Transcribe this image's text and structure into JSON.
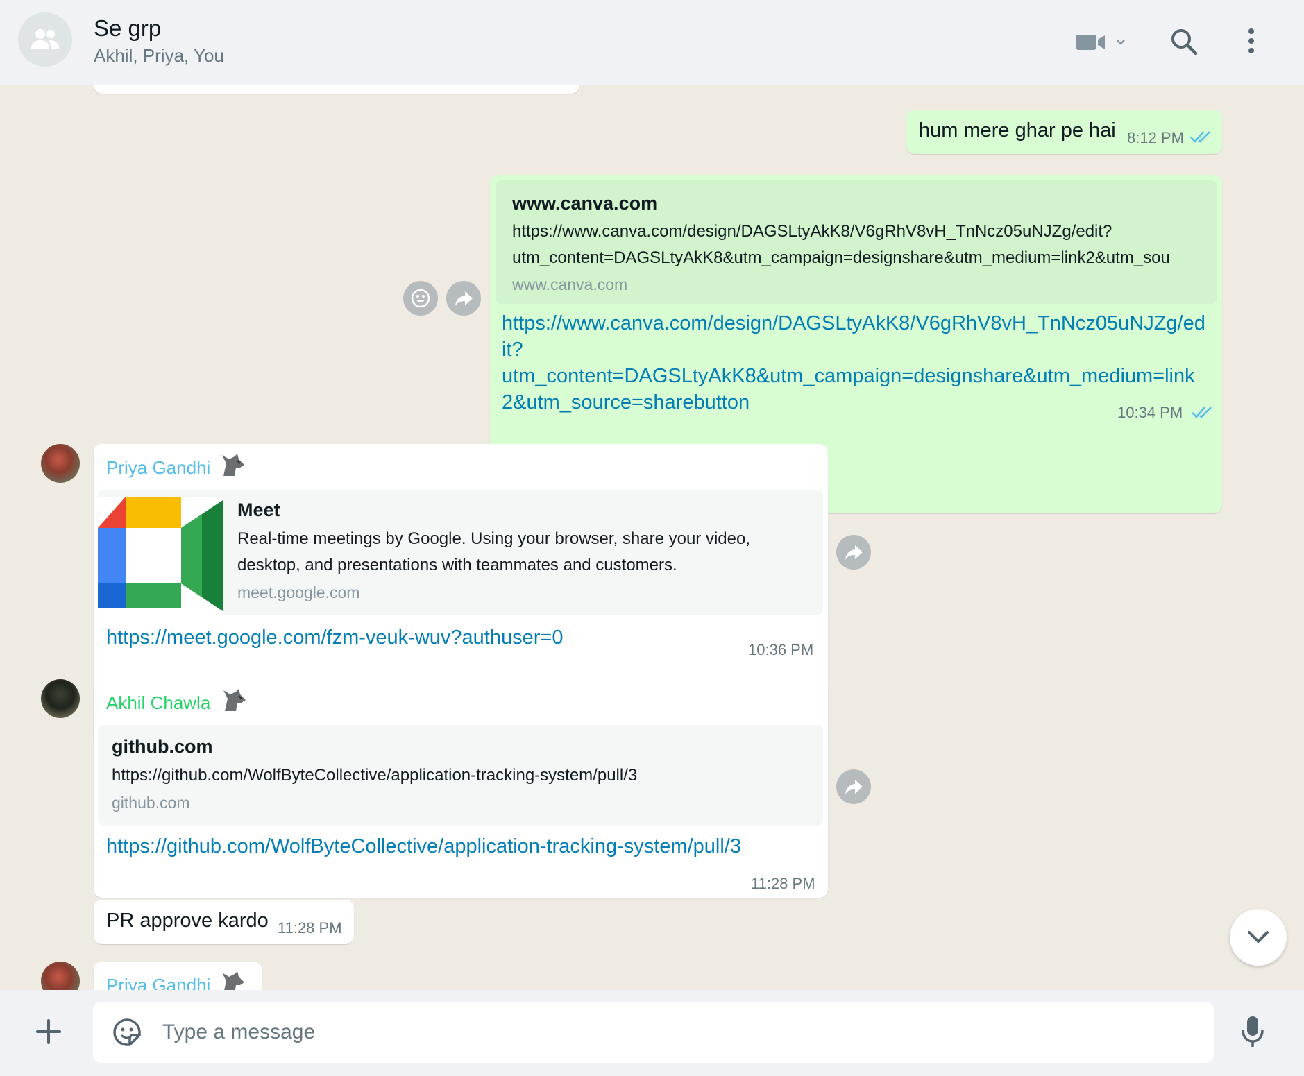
{
  "header": {
    "title": "Se grp",
    "members": "Akhil, Priya, You",
    "icons": [
      "group-avatar-icon",
      "video-call-icon",
      "search-icon",
      "menu-icon"
    ]
  },
  "messages": [
    {
      "text": "hum mere ghar pe hai",
      "time": "8:12 PM"
    },
    {
      "preview_title": "www.canva.com",
      "preview_desc_1": "https://www.canva.com/design/DAGSLtyAkK8/V6gRhV8vH_TnNcz05uNJZg/edit?",
      "preview_desc_2": "utm_content=DAGSLtyAkK8&utm_campaign=designshare&utm_medium=link2&utm_sou",
      "preview_domain": "www.canva.com",
      "link_1": "https://www.canva.com/design/DAGSLtyAkK8/V6gRhV8vH_TnNcz05uNJZg/ed",
      "link_2": "it?",
      "link_3": "utm_content=DAGSLtyAkK8&utm_campaign=designshare&utm_medium=link",
      "link_4": "2&utm_source=sharebutton",
      "time": "10:34 PM"
    },
    {
      "sender": "Priya Gandhi",
      "preview_title": "Meet",
      "preview_desc_1": "Real-time meetings by Google. Using your browser, share your video,",
      "preview_desc_2": "desktop, and presentations with teammates and customers.",
      "preview_domain": "meet.google.com",
      "link": "https://meet.google.com/fzm-veuk-wuv?authuser=0",
      "time": "10:36 PM"
    },
    {
      "sender": "Akhil Chawla",
      "preview_title": "github.com",
      "preview_desc_1": "https://github.com/WolfByteCollective/application-tracking-system/pull/3",
      "preview_domain": "github.com",
      "link": "https://github.com/WolfByteCollective/application-tracking-system/pull/3",
      "time": "11:28 PM"
    },
    {
      "text": "PR approve kardo",
      "time": "11:28 PM"
    },
    {
      "sender": "Priya Gandhi"
    }
  ],
  "composer": {
    "placeholder": "Type a message"
  },
  "colors": {
    "outgoing_bubble": "#d9fdd3",
    "incoming_bubble": "#ffffff",
    "link": "#027eb5",
    "priya_name": "#53bdeb",
    "akhil_name": "#25d366",
    "read_ticks": "#53bdeb"
  }
}
